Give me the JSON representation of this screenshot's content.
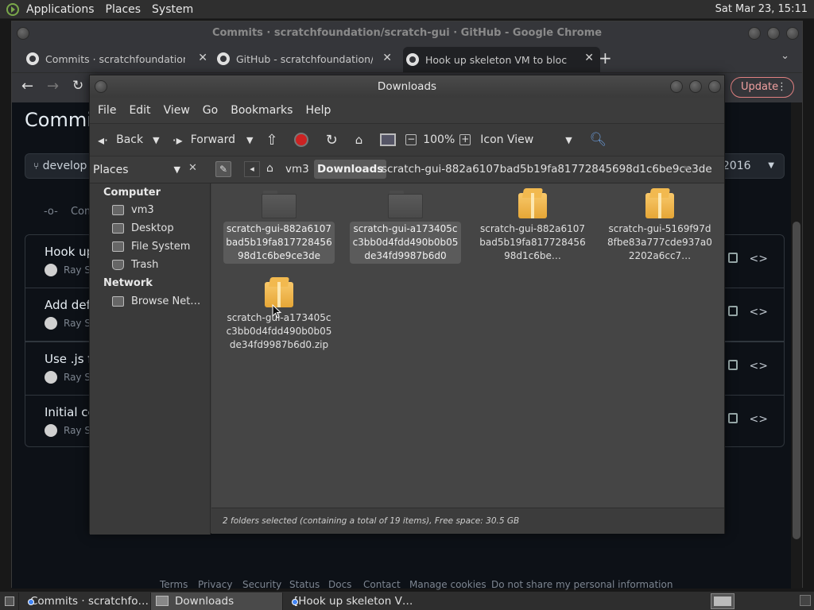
{
  "topbar": {
    "menus": [
      "Applications",
      "Places",
      "System"
    ],
    "clock": "Sat Mar 23, 15:11"
  },
  "chrome": {
    "window_title": "Commits · scratchfoundation/scratch-gui · GitHub - Google Chrome",
    "tabs": [
      {
        "label": "Commits · scratchfoundation/"
      },
      {
        "label": "GitHub - scratchfoundation/sc"
      },
      {
        "label": "Hook up skeleton VM to block"
      }
    ],
    "new_tab": "+",
    "update_label": "Update",
    "page": {
      "heading": "Commit",
      "branch": "develop",
      "date_filter": ", 2016",
      "commits_label": "Com",
      "rows": [
        {
          "title": "Hook up",
          "author": "Ray S"
        },
        {
          "title": "Add def",
          "author": "Ray S"
        },
        {
          "title": "Use .js f",
          "author": "Ray S"
        },
        {
          "title": "Initial co",
          "author": "Ray S"
        }
      ],
      "footer": [
        "Terms",
        "Privacy",
        "Security",
        "Status",
        "Docs",
        "Contact",
        "Manage cookies",
        "Do not share my personal information"
      ]
    }
  },
  "nautilus": {
    "title": "Downloads",
    "menu": [
      "File",
      "Edit",
      "View",
      "Go",
      "Bookmarks",
      "Help"
    ],
    "toolbar": {
      "back": "Back",
      "forward": "Forward",
      "zoom": "100%",
      "view": "Icon View"
    },
    "places_label": "Places",
    "path": [
      "vm3",
      "Downloads",
      "scratch-gui-882a6107bad5b19fa81772845698d1c6be9ce3de"
    ],
    "sidebar": {
      "computer_header": "Computer",
      "computer_items": [
        "vm3",
        "Desktop",
        "File System",
        "Trash"
      ],
      "network_header": "Network",
      "network_items": [
        "Browse Net…"
      ]
    },
    "files": [
      {
        "name": "scratch-gui-882a6107bad5b19fa81772845698d1c6be9ce3de",
        "type": "folder"
      },
      {
        "name": "scratch-gui-a173405cc3bb0d4fdd490b0b05de34fd9987b6d0",
        "type": "folder"
      },
      {
        "name": "scratch-gui-882a6107bad5b19fa81772845698d1c6be…",
        "type": "archive"
      },
      {
        "name": "scratch-gui-5169f97d8fbe83a777cde937a02202a6cc7…",
        "type": "archive"
      },
      {
        "name": "scratch-gui-a173405cc3bb0d4fdd490b0b05de34fd9987b6d0.zip",
        "type": "archive"
      }
    ],
    "status": "2 folders selected (containing a total of 19 items), Free space: 30.5 GB"
  },
  "taskbar": {
    "items": [
      "Commits · scratchfo…",
      "Downloads",
      "[Hook up skeleton V…"
    ]
  }
}
